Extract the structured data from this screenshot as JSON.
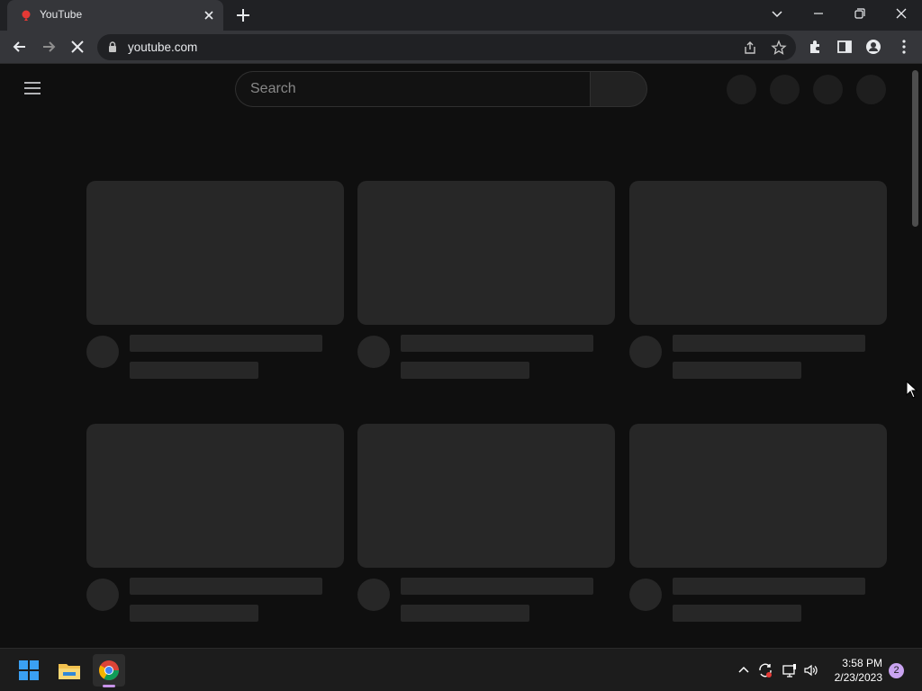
{
  "browser": {
    "tab_title": "YouTube",
    "url": "youtube.com"
  },
  "youtube": {
    "search_placeholder": "Search"
  },
  "taskbar": {
    "time": "3:58 PM",
    "date": "2/23/2023",
    "notification_count": "2"
  },
  "colors": {
    "page_background": "#0f0f0f",
    "skeleton": "#272727",
    "chrome_frame": "#202124",
    "chrome_toolbar": "#35363a"
  },
  "icons": {
    "tab_favicon": "youtube-logo-icon",
    "loading": "stop-loading-icon",
    "menu": "hamburger-menu-icon"
  }
}
